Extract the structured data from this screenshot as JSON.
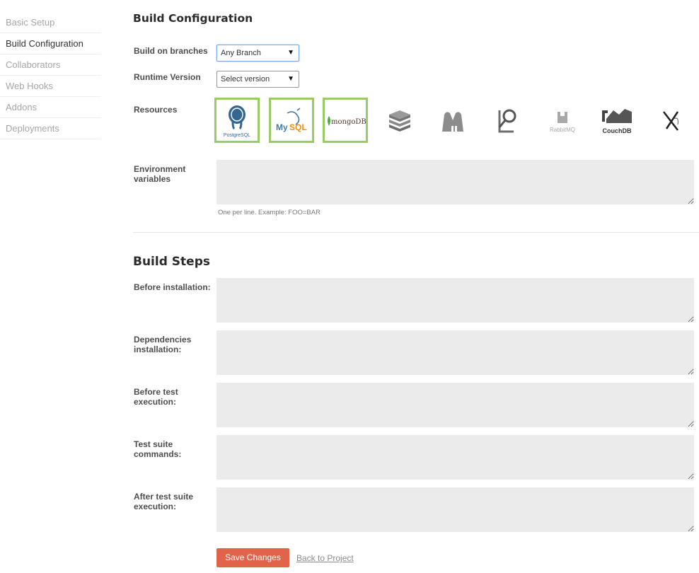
{
  "sidebar": {
    "items": [
      {
        "label": "Basic Setup"
      },
      {
        "label": "Build Configuration"
      },
      {
        "label": "Collaborators"
      },
      {
        "label": "Web Hooks"
      },
      {
        "label": "Addons"
      },
      {
        "label": "Deployments"
      }
    ]
  },
  "build_config": {
    "title": "Build Configuration",
    "branches_label": "Build on branches",
    "branches_value": "Any Branch",
    "runtime_label": "Runtime Version",
    "runtime_value": "Select version",
    "resources_label": "Resources",
    "resources": [
      {
        "name": "PostgreSQL",
        "selected": true
      },
      {
        "name": "MySQL",
        "selected": true
      },
      {
        "name": "mongoDB",
        "selected": true
      },
      {
        "name": "redis",
        "selected": false
      },
      {
        "name": "memcached",
        "selected": false
      },
      {
        "name": "elasticsearch",
        "selected": false
      },
      {
        "name": "RabbitMQ",
        "selected": false
      },
      {
        "name": "CouchDB",
        "selected": false
      },
      {
        "name": "xvfb",
        "selected": false
      }
    ],
    "env_label_line1": "Environment",
    "env_label_line2": "variables",
    "env_value": "",
    "env_hint": "One per line. Example: FOO=BAR"
  },
  "build_steps": {
    "title": "Build Steps",
    "steps": [
      {
        "line1": "Before installation:",
        "line2": "",
        "value": ""
      },
      {
        "line1": "Dependencies",
        "line2": "installation:",
        "value": ""
      },
      {
        "line1": "Before test",
        "line2": "execution:",
        "value": ""
      },
      {
        "line1": "Test suite",
        "line2": "commands:",
        "value": ""
      },
      {
        "line1": "After test suite",
        "line2": "execution:",
        "value": ""
      }
    ]
  },
  "actions": {
    "save_label": "Save Changes",
    "back_label": "Back to Project"
  },
  "colors": {
    "save_button": "#e1644a",
    "selected_border": "#99cc66",
    "textarea_bg": "#ebebeb"
  }
}
